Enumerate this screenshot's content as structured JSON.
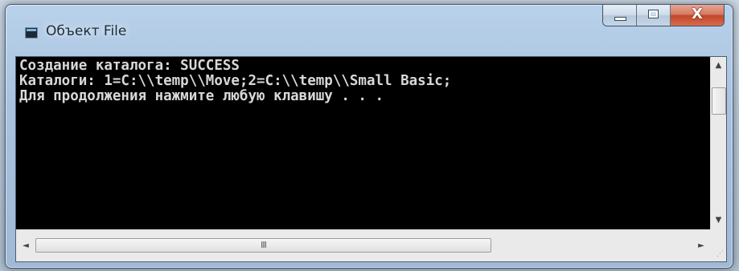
{
  "window": {
    "title": "Объект File",
    "buttons": {
      "minimize": "minimize-icon",
      "maximize": "maximize-icon",
      "close_glyph": "X"
    }
  },
  "console": {
    "lines": [
      "Создание каталога: SUCCESS",
      "Каталоги: 1=C:\\\\temp\\\\Move;2=C:\\\\temp\\\\Small Basic;",
      "Для продолжения нажмите любую клавишу . . ."
    ],
    "background": "#000000",
    "text_color": "#d8d8d8"
  },
  "scrollbars": {
    "horizontal_thumb_grip": "III",
    "arrows": {
      "up": "▲",
      "down": "▼",
      "left": "◄",
      "right": "►"
    }
  }
}
